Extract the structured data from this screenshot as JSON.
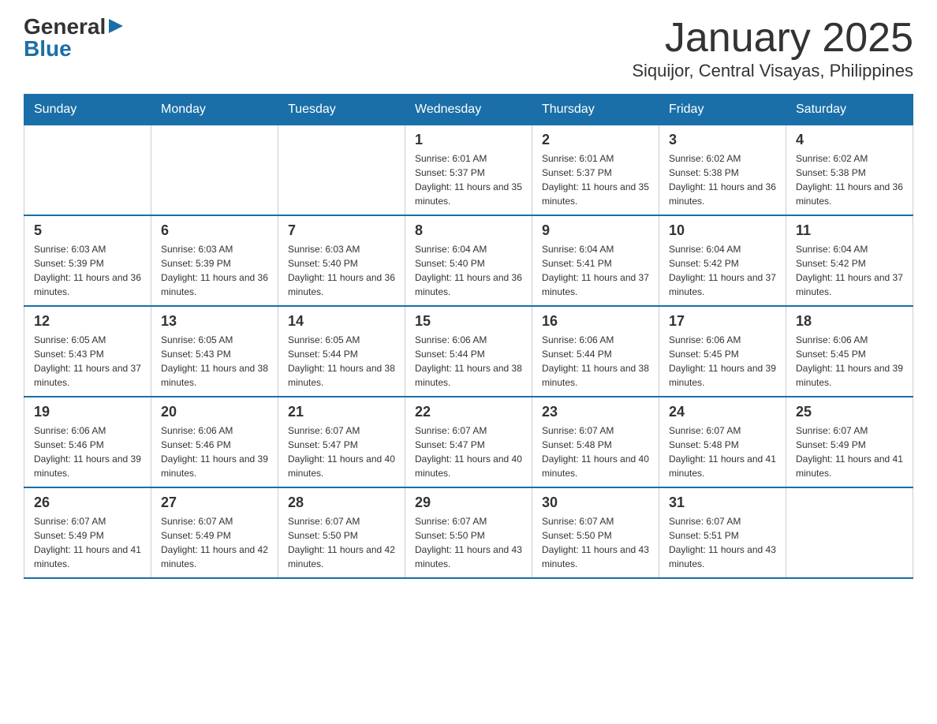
{
  "header": {
    "logo_general": "General",
    "logo_blue": "Blue",
    "month_title": "January 2025",
    "location": "Siquijor, Central Visayas, Philippines"
  },
  "days_of_week": [
    "Sunday",
    "Monday",
    "Tuesday",
    "Wednesday",
    "Thursday",
    "Friday",
    "Saturday"
  ],
  "weeks": [
    [
      {
        "day": "",
        "info": ""
      },
      {
        "day": "",
        "info": ""
      },
      {
        "day": "",
        "info": ""
      },
      {
        "day": "1",
        "info": "Sunrise: 6:01 AM\nSunset: 5:37 PM\nDaylight: 11 hours and 35 minutes."
      },
      {
        "day": "2",
        "info": "Sunrise: 6:01 AM\nSunset: 5:37 PM\nDaylight: 11 hours and 35 minutes."
      },
      {
        "day": "3",
        "info": "Sunrise: 6:02 AM\nSunset: 5:38 PM\nDaylight: 11 hours and 36 minutes."
      },
      {
        "day": "4",
        "info": "Sunrise: 6:02 AM\nSunset: 5:38 PM\nDaylight: 11 hours and 36 minutes."
      }
    ],
    [
      {
        "day": "5",
        "info": "Sunrise: 6:03 AM\nSunset: 5:39 PM\nDaylight: 11 hours and 36 minutes."
      },
      {
        "day": "6",
        "info": "Sunrise: 6:03 AM\nSunset: 5:39 PM\nDaylight: 11 hours and 36 minutes."
      },
      {
        "day": "7",
        "info": "Sunrise: 6:03 AM\nSunset: 5:40 PM\nDaylight: 11 hours and 36 minutes."
      },
      {
        "day": "8",
        "info": "Sunrise: 6:04 AM\nSunset: 5:40 PM\nDaylight: 11 hours and 36 minutes."
      },
      {
        "day": "9",
        "info": "Sunrise: 6:04 AM\nSunset: 5:41 PM\nDaylight: 11 hours and 37 minutes."
      },
      {
        "day": "10",
        "info": "Sunrise: 6:04 AM\nSunset: 5:42 PM\nDaylight: 11 hours and 37 minutes."
      },
      {
        "day": "11",
        "info": "Sunrise: 6:04 AM\nSunset: 5:42 PM\nDaylight: 11 hours and 37 minutes."
      }
    ],
    [
      {
        "day": "12",
        "info": "Sunrise: 6:05 AM\nSunset: 5:43 PM\nDaylight: 11 hours and 37 minutes."
      },
      {
        "day": "13",
        "info": "Sunrise: 6:05 AM\nSunset: 5:43 PM\nDaylight: 11 hours and 38 minutes."
      },
      {
        "day": "14",
        "info": "Sunrise: 6:05 AM\nSunset: 5:44 PM\nDaylight: 11 hours and 38 minutes."
      },
      {
        "day": "15",
        "info": "Sunrise: 6:06 AM\nSunset: 5:44 PM\nDaylight: 11 hours and 38 minutes."
      },
      {
        "day": "16",
        "info": "Sunrise: 6:06 AM\nSunset: 5:44 PM\nDaylight: 11 hours and 38 minutes."
      },
      {
        "day": "17",
        "info": "Sunrise: 6:06 AM\nSunset: 5:45 PM\nDaylight: 11 hours and 39 minutes."
      },
      {
        "day": "18",
        "info": "Sunrise: 6:06 AM\nSunset: 5:45 PM\nDaylight: 11 hours and 39 minutes."
      }
    ],
    [
      {
        "day": "19",
        "info": "Sunrise: 6:06 AM\nSunset: 5:46 PM\nDaylight: 11 hours and 39 minutes."
      },
      {
        "day": "20",
        "info": "Sunrise: 6:06 AM\nSunset: 5:46 PM\nDaylight: 11 hours and 39 minutes."
      },
      {
        "day": "21",
        "info": "Sunrise: 6:07 AM\nSunset: 5:47 PM\nDaylight: 11 hours and 40 minutes."
      },
      {
        "day": "22",
        "info": "Sunrise: 6:07 AM\nSunset: 5:47 PM\nDaylight: 11 hours and 40 minutes."
      },
      {
        "day": "23",
        "info": "Sunrise: 6:07 AM\nSunset: 5:48 PM\nDaylight: 11 hours and 40 minutes."
      },
      {
        "day": "24",
        "info": "Sunrise: 6:07 AM\nSunset: 5:48 PM\nDaylight: 11 hours and 41 minutes."
      },
      {
        "day": "25",
        "info": "Sunrise: 6:07 AM\nSunset: 5:49 PM\nDaylight: 11 hours and 41 minutes."
      }
    ],
    [
      {
        "day": "26",
        "info": "Sunrise: 6:07 AM\nSunset: 5:49 PM\nDaylight: 11 hours and 41 minutes."
      },
      {
        "day": "27",
        "info": "Sunrise: 6:07 AM\nSunset: 5:49 PM\nDaylight: 11 hours and 42 minutes."
      },
      {
        "day": "28",
        "info": "Sunrise: 6:07 AM\nSunset: 5:50 PM\nDaylight: 11 hours and 42 minutes."
      },
      {
        "day": "29",
        "info": "Sunrise: 6:07 AM\nSunset: 5:50 PM\nDaylight: 11 hours and 43 minutes."
      },
      {
        "day": "30",
        "info": "Sunrise: 6:07 AM\nSunset: 5:50 PM\nDaylight: 11 hours and 43 minutes."
      },
      {
        "day": "31",
        "info": "Sunrise: 6:07 AM\nSunset: 5:51 PM\nDaylight: 11 hours and 43 minutes."
      },
      {
        "day": "",
        "info": ""
      }
    ]
  ]
}
